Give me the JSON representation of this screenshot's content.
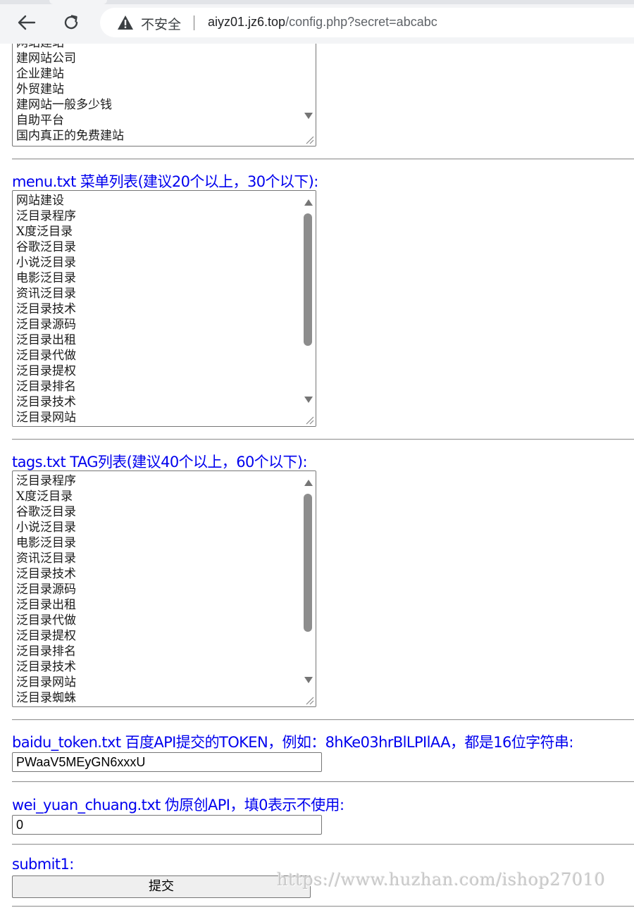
{
  "browser": {
    "insecure_label": "不安全",
    "url_host": "aiyz01.jz6.top",
    "url_path": "/config.php?secret=abcabc"
  },
  "keywords_box": {
    "lines": [
      "网站建站",
      "建网站公司",
      "企业建站",
      "外贸建站",
      "建网站一般多少钱",
      "自助平台",
      "国内真正的免费建站"
    ]
  },
  "menu_section": {
    "label": "menu.txt 菜单列表(建议20个以上，30个以下):",
    "lines": [
      "网站建设",
      "泛目录程序",
      "X度泛目录",
      "谷歌泛目录",
      "小说泛目录",
      "电影泛目录",
      "资讯泛目录",
      "泛目录技术",
      "泛目录源码",
      "泛目录出租",
      "泛目录代做",
      "泛目录提权",
      "泛目录排名",
      "泛目录技术",
      "泛目录网站"
    ]
  },
  "tags_section": {
    "label": "tags.txt TAG列表(建议40个以上，60个以下):",
    "lines": [
      "泛目录程序",
      "X度泛目录",
      "谷歌泛目录",
      "小说泛目录",
      "电影泛目录",
      "资讯泛目录",
      "泛目录技术",
      "泛目录源码",
      "泛目录出租",
      "泛目录代做",
      "泛目录提权",
      "泛目录排名",
      "泛目录技术",
      "泛目录网站",
      "泛目录蜘蛛"
    ]
  },
  "baidu_section": {
    "label": "baidu_token.txt 百度API提交的TOKEN，例如：8hKe03hrBlLPIlAA，都是16位字符串:",
    "value": "PWaaV5MEyGN6xxxU"
  },
  "wei_section": {
    "label": "wei_yuan_chuang.txt 伪原创API，填0表示不使用:",
    "value": "0"
  },
  "submit_section": {
    "label": "submit1:",
    "button_label": "提交"
  },
  "watermark": "https://www.huzhan.com/ishop27010",
  "colors": {
    "label_blue": "#0000ee",
    "chrome_bg": "#f3f4f6"
  },
  "icons": [
    "back-arrow-icon",
    "reload-icon",
    "warning-icon",
    "resize-grip-icon"
  ]
}
